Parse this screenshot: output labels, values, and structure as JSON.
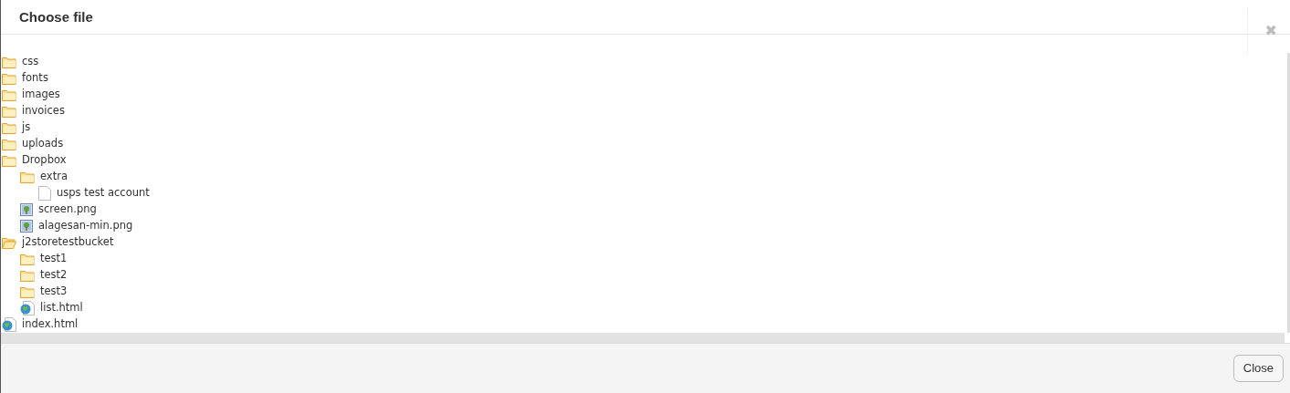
{
  "dialog": {
    "title": "Choose file",
    "close_symbol": "✖"
  },
  "tree": [
    {
      "label": "css",
      "kind": "folder"
    },
    {
      "label": "fonts",
      "kind": "folder"
    },
    {
      "label": "images",
      "kind": "folder"
    },
    {
      "label": "invoices",
      "kind": "folder"
    },
    {
      "label": "js",
      "kind": "folder"
    },
    {
      "label": "uploads",
      "kind": "folder"
    },
    {
      "label": "Dropbox",
      "kind": "folder",
      "children": [
        {
          "label": "extra",
          "kind": "folder",
          "children": [
            {
              "label": "usps test account",
              "kind": "file"
            }
          ]
        },
        {
          "label": "screen.png",
          "kind": "image"
        },
        {
          "label": "alagesan-min.png",
          "kind": "image"
        }
      ]
    },
    {
      "label": "j2storetestbucket",
      "kind": "folder-open",
      "children": [
        {
          "label": "test1",
          "kind": "folder"
        },
        {
          "label": "test2",
          "kind": "folder"
        },
        {
          "label": "test3",
          "kind": "folder"
        },
        {
          "label": "list.html",
          "kind": "web"
        }
      ]
    },
    {
      "label": "index.html",
      "kind": "web"
    }
  ],
  "footer": {
    "buttons": [
      "Close"
    ]
  }
}
